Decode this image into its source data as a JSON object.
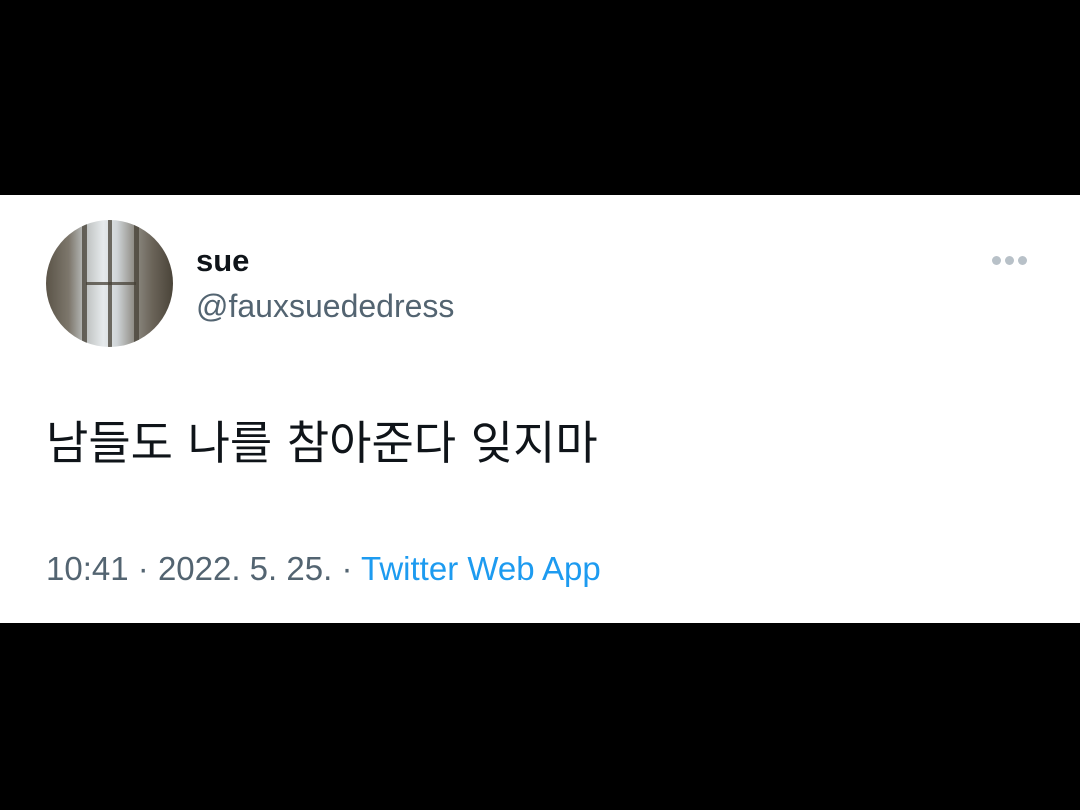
{
  "tweet": {
    "author": {
      "display_name": "sue",
      "handle": "@fauxsuededress"
    },
    "more_icon": "more-horizontal-icon",
    "text": "남들도 나를 참아준다 잊지마",
    "time": "10:41",
    "separator": "·",
    "date": "2022. 5. 25.",
    "source": "Twitter Web App"
  },
  "colors": {
    "background": "#000000",
    "card": "#ffffff",
    "primary_text": "#0f1419",
    "secondary_text": "#536471",
    "link": "#1d9bf0",
    "more_dots": "#b8c1c8"
  }
}
